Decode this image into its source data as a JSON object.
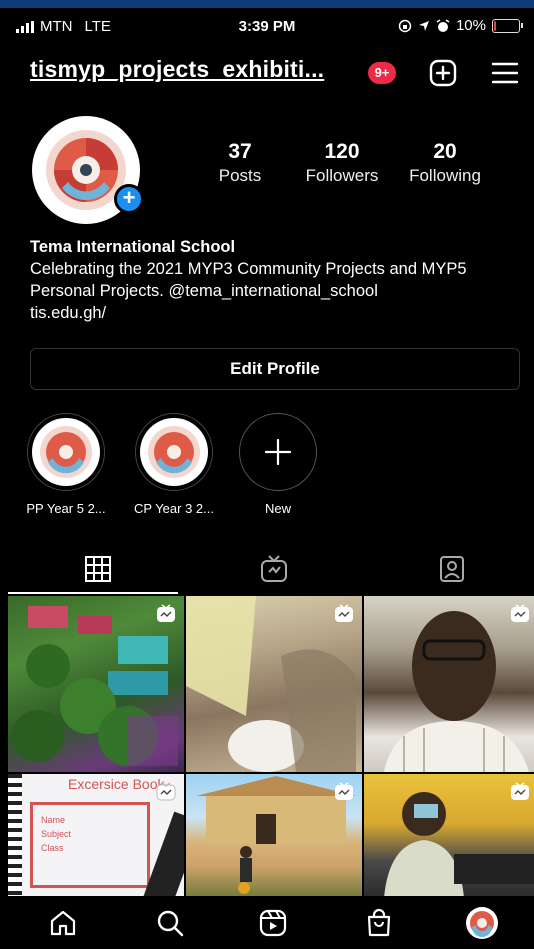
{
  "status": {
    "carrier": "MTN",
    "network": "LTE",
    "time": "3:39 PM",
    "battery": "10%",
    "battery_level": 0.1,
    "icons": [
      "lock-rotation-icon",
      "location-arrow-icon",
      "alarm-icon"
    ]
  },
  "header": {
    "username": "tismyp_projects_exhibiti...",
    "notifications": "9+",
    "icons": [
      "new-post-icon",
      "menu-icon"
    ]
  },
  "profile": {
    "posts": {
      "count": "37",
      "label": "Posts"
    },
    "followers": {
      "count": "120",
      "label": "Followers"
    },
    "following": {
      "count": "20",
      "label": "Following"
    }
  },
  "bio": {
    "name": "Tema International School",
    "text": "Celebrating the 2021 MYP3 Community Projects and MYP5 Personal Projects. @tema_international_school",
    "link": "tis.edu.gh/"
  },
  "edit_profile": "Edit Profile",
  "highlights": [
    {
      "label": "PP Year 5 2..."
    },
    {
      "label": "CP Year 3 2..."
    },
    {
      "label": "New"
    }
  ],
  "tabs": [
    "grid-icon",
    "igtv-icon",
    "tagged-icon"
  ],
  "posts_grid": [
    {
      "type": "reel"
    },
    {
      "type": "reel"
    },
    {
      "type": "reel"
    },
    {
      "type": "reel",
      "text": "Excersice Book"
    },
    {
      "type": "reel"
    },
    {
      "type": "reel"
    }
  ],
  "post4": {
    "title": "Excersice Book",
    "fields": [
      "Name",
      "Subject",
      "Class"
    ]
  },
  "bottom_nav": [
    "home-icon",
    "search-icon",
    "reels-icon",
    "shop-icon",
    "profile-avatar"
  ],
  "colors": {
    "accent": "#1c8ef1",
    "badge": "#ed2b45",
    "background": "#000000"
  }
}
